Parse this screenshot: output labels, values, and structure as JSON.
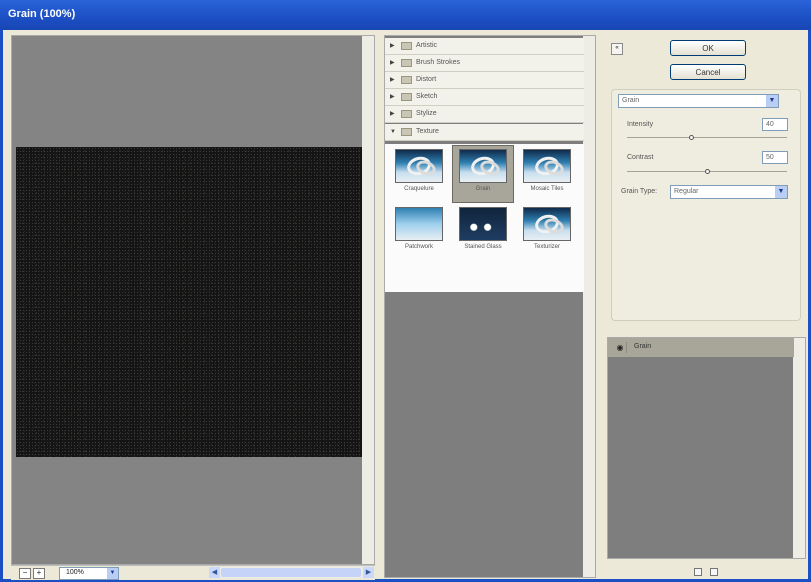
{
  "window": {
    "title": "Grain (100%)"
  },
  "preview": {
    "zoom_value": "100%"
  },
  "filter_tree": {
    "categories": [
      {
        "label": "Artistic"
      },
      {
        "label": "Brush Strokes"
      },
      {
        "label": "Distort"
      },
      {
        "label": "Sketch"
      },
      {
        "label": "Stylize"
      },
      {
        "label": "Texture"
      }
    ],
    "texture_filters": [
      {
        "label": "Craquelure"
      },
      {
        "label": "Grain"
      },
      {
        "label": "Mosaic Tiles"
      },
      {
        "label": "Patchwork"
      },
      {
        "label": "Stained Glass"
      },
      {
        "label": "Texturizer"
      }
    ],
    "selected_filter": "Grain"
  },
  "controls": {
    "ok_label": "OK",
    "cancel_label": "Cancel",
    "filter_select": "Grain",
    "intensity_label": "Intensity",
    "intensity_value": "40",
    "intensity_fraction": 0.4,
    "contrast_label": "Contrast",
    "contrast_value": "50",
    "contrast_fraction": 0.5,
    "grain_type_label": "Grain Type:",
    "grain_type_value": "Regular"
  },
  "effect_layers": [
    {
      "name": "Grain"
    }
  ]
}
